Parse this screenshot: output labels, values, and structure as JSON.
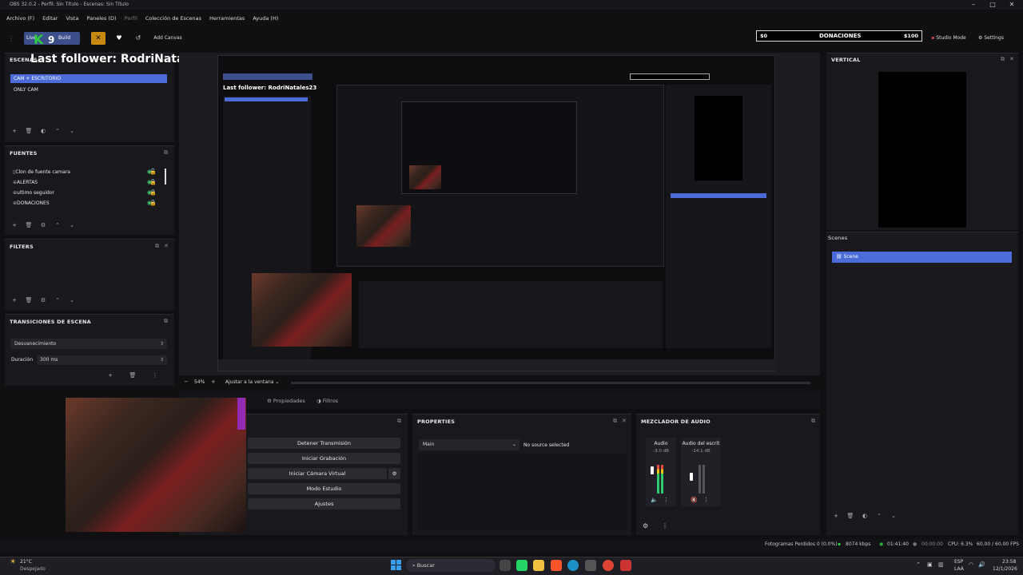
{
  "window": {
    "title": "OBS 32.0.2 - Perfil: Sin Título - Escenas: Sin Título"
  },
  "menu": [
    "Archivo (F)",
    "Editar",
    "Vista",
    "Paneles (D)",
    "Perfil",
    "Colección de Escenas",
    "Herramientas",
    "Ayuda (H)"
  ],
  "toolbar": {
    "live_label": "Live",
    "build_label": "Build",
    "add_canvas": "Add Canvas",
    "donations_min": "$0",
    "donations_label": "DONACIONES",
    "donations_max": "$100",
    "donations_progress": 0,
    "studio_mode": "Studio Mode",
    "settings": "Settings"
  },
  "overlay": {
    "last_follower": "Last follower: RodriNatales23",
    "k_badge": "K",
    "count": "9"
  },
  "scenes": {
    "title": "ESCENAS",
    "items": [
      "CAM + ESCRITORIO",
      "ONLY CAM"
    ],
    "selected": 0
  },
  "sources": {
    "title": "FUENTES",
    "items": [
      "Clon de fuente camara",
      "ALERTAS",
      "ultimo seguidor",
      "DONACIONES"
    ]
  },
  "filters": {
    "title": "FILTERS"
  },
  "transitions": {
    "title": "TRANSICIONES DE ESCENA",
    "selected": "Desvanecimiento",
    "duration_label": "Duración",
    "duration_value": "300 ms"
  },
  "preview": {
    "zoom": "54%",
    "fit_label": "Ajustar a la ventana",
    "tab_properties": "Propiedades",
    "tab_filters": "Filtros"
  },
  "controls": {
    "buttons": [
      "Detener Transmisión",
      "Iniciar Grabación",
      "Iniciar Cámara Virtual",
      "Modo Estudio",
      "Ajustes"
    ]
  },
  "properties": {
    "title": "PROPERTIES",
    "dropdown": "Main",
    "message": "No source selected"
  },
  "mixer": {
    "title": "MEZCLADOR DE AUDIO",
    "channels": [
      {
        "name": "Audio",
        "db": "-3.0 dB"
      },
      {
        "name": "Audio del escrit",
        "db": "-14.1 dB"
      }
    ]
  },
  "vertical": {
    "title": "VERTICAL",
    "scenes_title": "Scenes",
    "scene_item": "Scene"
  },
  "status": {
    "dropped": "Fotogramas Perdidos 0 (0.0%)",
    "bitrate": "8074 kbps",
    "stream_time": "01:41:40",
    "rec_time": "00:00:00",
    "cpu": "CPU: 6.3%",
    "fps": "60.00 / 60.00 FPS"
  },
  "taskbar": {
    "weather_temp": "21°C",
    "weather_desc": "Despejado",
    "search": "Buscar",
    "lang1": "ESP",
    "lang2": "LAA",
    "time": "23:58",
    "date": "12/1/2026"
  },
  "colors": {
    "accent": "#4a6bd8",
    "live": "#2ecc40",
    "orange": "#c98a12"
  }
}
